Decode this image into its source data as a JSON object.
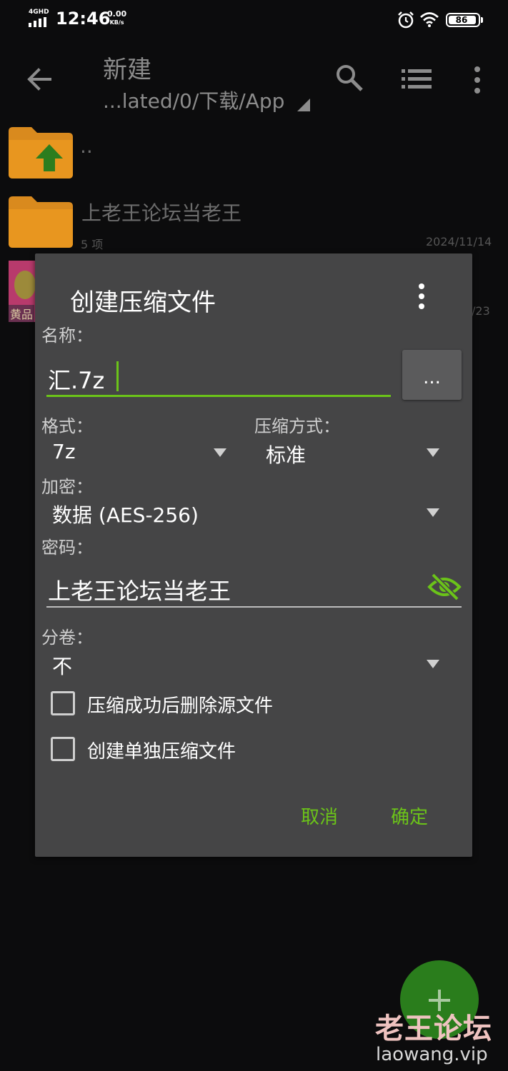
{
  "status_bar": {
    "network": "4GHD",
    "time": "12:46",
    "speed_value": "0.00",
    "speed_unit": "KB/s",
    "battery": "86",
    "icons": [
      "signal-icon",
      "alarm-icon",
      "wifi-icon",
      "battery-icon"
    ]
  },
  "app_bar": {
    "title": "新建",
    "path": "...lated/0/下载/App",
    "icons": [
      "back-arrow-icon",
      "search-icon",
      "list-view-icon",
      "more-vert-icon"
    ]
  },
  "file_list": {
    "items": [
      {
        "name": "..",
        "icon": "folder-up-icon"
      },
      {
        "name": "上老王论坛当老王",
        "meta": "5 项",
        "date": "2024/11/14",
        "icon": "folder-icon"
      },
      {
        "thumb_label": "黄品",
        "date": "/23",
        "icon": "image-thumbnail"
      }
    ]
  },
  "dialog": {
    "title": "创建压缩文件",
    "name_label": "名称：",
    "name_value": "汇.7z",
    "browse_label": "...",
    "format_label": "格式：",
    "format_value": "7z",
    "method_label": "压缩方式：",
    "method_value": "标准",
    "encryption_label": "加密：",
    "encryption_value": "数据 (AES-256)",
    "password_label": "密码：",
    "password_value": "上老王论坛当老王",
    "volume_label": "分卷：",
    "volume_value": "不",
    "checkbox_delete": {
      "label": "压缩成功后删除源文件",
      "checked": false
    },
    "checkbox_separate": {
      "label": "创建单独压缩文件",
      "checked": false
    },
    "cancel_label": "取消",
    "ok_label": "确定"
  },
  "fab": {
    "icon": "plus-icon"
  },
  "watermark": {
    "main": "老王论坛",
    "sub": "laowang.vip"
  },
  "colors": {
    "accent": "#6bc319",
    "dialog_bg": "#454546",
    "screen_bg": "#0c0c0d",
    "folder": "#d98a1e",
    "fab": "#2a7d1c"
  }
}
